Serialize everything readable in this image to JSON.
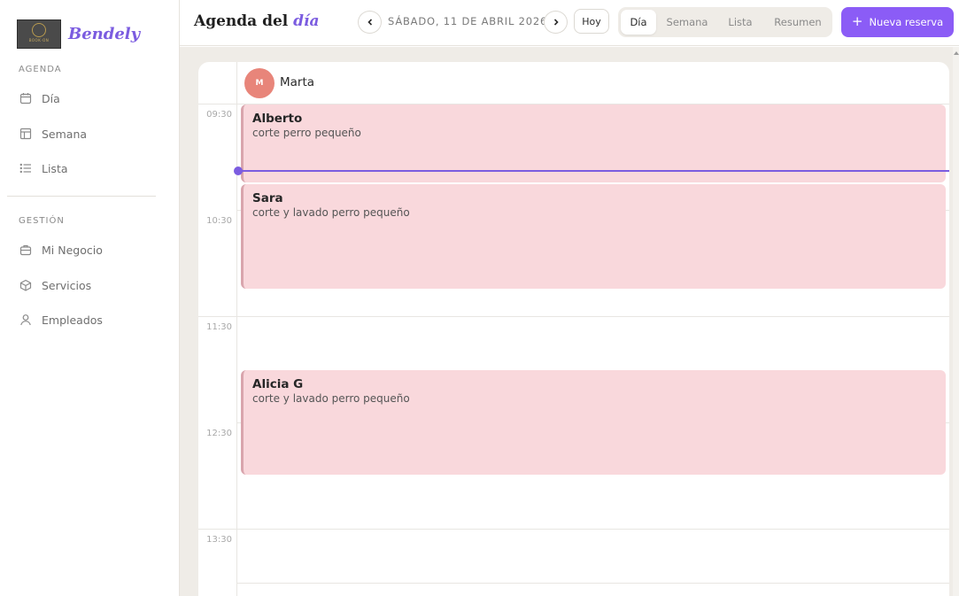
{
  "brand": {
    "name": "Bendely",
    "logo_text": "BOOK·ON"
  },
  "sidebar": {
    "section_agenda": "AGENDA",
    "section_gestion": "GESTIÓN",
    "agenda_items": [
      {
        "label": "Día",
        "icon": "calendar-icon"
      },
      {
        "label": "Semana",
        "icon": "grid-icon"
      },
      {
        "label": "Lista",
        "icon": "list-icon"
      }
    ],
    "gestion_items": [
      {
        "label": "Mi Negocio",
        "icon": "briefcase-icon"
      },
      {
        "label": "Servicios",
        "icon": "box-icon"
      },
      {
        "label": "Empleados",
        "icon": "user-icon"
      }
    ]
  },
  "header": {
    "title_prefix": "Agenda del ",
    "title_highlight": "día",
    "date": "SÁBADO, 11 DE ABRIL 2026",
    "today_label": "Hoy",
    "views": [
      "Día",
      "Semana",
      "Lista",
      "Resumen"
    ],
    "active_view": "Día",
    "new_booking_label": "Nueva reserva"
  },
  "calendar": {
    "employee": {
      "initial": "M",
      "name": "Marta"
    },
    "time_labels": [
      "09:30",
      "10:30",
      "11:30",
      "12:30",
      "13:30"
    ],
    "events": [
      {
        "client": "Alberto",
        "service": "corte perro pequeño"
      },
      {
        "client": "Sara",
        "service": "corte y lavado perro pequeño"
      },
      {
        "client": "Alicia G",
        "service": "corte y lavado perro pequeño"
      }
    ]
  },
  "colors": {
    "accent": "#7b5ce0",
    "primary_button": "#8b5cf6",
    "event_bg": "#f9d8dc",
    "avatar": "#e8857a"
  }
}
